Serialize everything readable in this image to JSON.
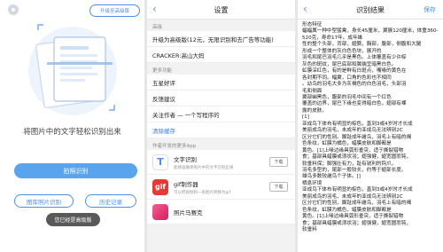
{
  "home": {
    "upgrade_button": "升级至高级版",
    "tagline": "将图片中的文字轻松识别出来",
    "capture_button": "拍照识别",
    "album_button": "图库照片识别",
    "history_button": "历史记录",
    "toast": "您已经是高级版"
  },
  "settings": {
    "title": "设置",
    "section_advanced": "高级",
    "upgrade_row": "升级为高级版(12元，无限识别和去广告等功能)",
    "cracker_row": "CRACKER:高山大妈",
    "section_more": "更多功能",
    "rows": [
      "五星好评",
      "反馈建议",
      "关注作者 — 一个写程序的",
      "清除缓存"
    ],
    "section_apps": "作者开发的更多App",
    "apps": [
      {
        "name": "文字识别",
        "desc": "能够准确将照片中的文字识别出来",
        "action": "下载",
        "icon_text": "T",
        "icon_color": "#ffffff",
        "icon_fg": "#4a90e2"
      },
      {
        "name": "gif制作器",
        "desc": "可以把视频和一串图片转换为gif",
        "action": "下载",
        "icon_text": "gif",
        "icon_color": "#e53935",
        "icon_fg": "#ffffff"
      },
      {
        "name": "照片马赛克",
        "desc": "",
        "action": "",
        "icon_text": "",
        "icon_color": "#d81b60",
        "icon_fg": "#ffffff"
      }
    ]
  },
  "result": {
    "title": "识别结果",
    "save": "保存",
    "lines": [
      "形态特征",
      "蝠蝠属一种中型猛禽，身长45厘米，翼展120厘米，体重360-520克，寿命17年。成年雄",
      "性的整个头部，背部，翅膀，胸部，腹部，侧腹和大腿",
      "形成一个整体的灰白色色块，展开的",
      "羽毛和尾巴羽毛几乎是黑色。上体覆盖有少许棕",
      "灰色的斑纹，尾巴底部和翼端呈暗黑白色。",
      "虹膜深红色，有的是鲜有白斑点，嘴喙的黄色在",
      "各封期不同。幅翼，口角的色彩也不相同",
      "。幼鸟的羽毛大多为灰褐色的白色羽毛，头部羽",
      "毛和侧面",
      "翼部幽黑色，腹部的羽毛中间有一个红色",
      "覆盖的边界，尾巴下缘也变得暗白色，翅部有裸",
      "露的皮肤。",
      "[1]",
      "亚成鸟下体布有明显的棕色，直到3或4岁时才长成",
      "美丽成鸟的羽毛，未成年的亚成鸟无法辨别2C",
      "区分它们的性别。脚趾成年雌鸟，羽毛上有暗的褐",
      "色条纹，虹膜为橘色，蜡膜皮肤和脚都是",
      "黄色。[1]上喙边缘具弧形垂突，适于撕裂猎物",
      "食；基部具蜡膜或须状羽；翅强健，翅宽圆而钝，",
      "软垂料保；脚强壮有力，趾有锐利的钩爪，",
      "羽毛多型的，尾部一般较长，约等于翅部长度。",
      "雄鸟多数较雌鸟个子体。[]",
      "栖息环境",
      "亚成鸟下体布有明显的棕色，直到3或4岁时才长成",
      "美丽成鸟的羽毛，未成年的亚成鸟无法辨别2C",
      "区分它们的性别，脚趾成年雌鸟，羽毛上有暗的褐",
      "色条纹，虹膜为橘色，蜡膜皮肤和脚都是",
      "黄色。[1]上喙边缘具弧形垂突，适于撕裂猎物",
      "食；基部具蜡膜或须状羽；翅强健，翅宽圆而钝，",
      "软垂料"
    ]
  }
}
